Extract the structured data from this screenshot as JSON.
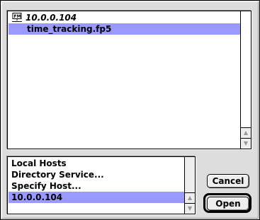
{
  "file_list": {
    "server": {
      "name": "10.0.0.104",
      "icon": "fm-server-icon"
    },
    "files": [
      {
        "name": "time_tracking.fp5",
        "selected": true
      }
    ]
  },
  "host_list": {
    "items": [
      {
        "label": "Local Hosts",
        "selected": false
      },
      {
        "label": "Directory Service...",
        "selected": false
      },
      {
        "label": "Specify Host...",
        "selected": false
      },
      {
        "label": "10.0.0.104",
        "selected": true
      }
    ]
  },
  "buttons": {
    "cancel_label": "Cancel",
    "open_label": "Open"
  },
  "colors": {
    "selection": "#9999ff",
    "background": "#dddddd"
  }
}
